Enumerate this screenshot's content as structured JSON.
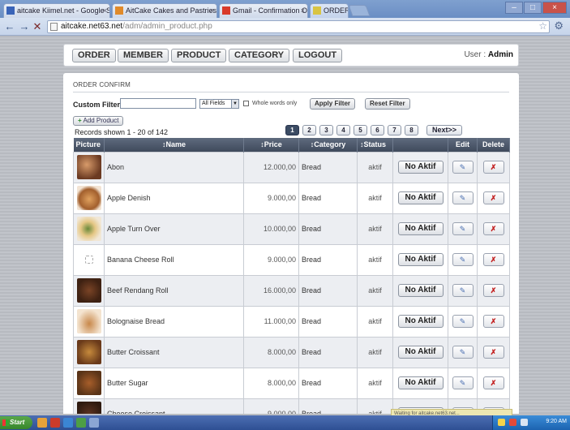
{
  "browser": {
    "tabs": [
      {
        "label": "aitcake Kiimel.net - Google S",
        "fav": "#3a64b8"
      },
      {
        "label": "AitCake Cakes and Pastries",
        "fav": "#e08a2a"
      },
      {
        "label": "Gmail - Confirmation Order",
        "fav": "#d93a2a"
      },
      {
        "label": "ORDER Order",
        "fav": "#d9c442"
      }
    ],
    "url_host": "aitcake.net63.net",
    "url_path": "/adm/admin_product.php",
    "close_glyph": "×",
    "window_buttons": [
      "–",
      "□",
      "×"
    ]
  },
  "nav": {
    "items": [
      "ORDER",
      "MEMBER",
      "PRODUCT",
      "CATEGORY",
      "LOGOUT"
    ],
    "user_label": "User :",
    "user_name": "Admin"
  },
  "content": {
    "section_title": "ORDER CONFIRM",
    "filter": {
      "label": "Custom Filter",
      "input_value": "",
      "field_select": "All Fields",
      "whole_words_label": "Whole words only",
      "apply_label": "Apply Filter",
      "reset_label": "Reset Filter"
    },
    "add_product": "Add Product",
    "records_text": "Records shown 1 - 20 of 142",
    "pagination": {
      "pages": [
        "1",
        "2",
        "3",
        "4",
        "5",
        "6",
        "7",
        "8"
      ],
      "active": "1",
      "next": "Next>>"
    },
    "columns": {
      "picture": "Picture",
      "name": "↕Name",
      "price": "↕Price",
      "category": "↕Category",
      "status": "↕Status",
      "edit": "Edit",
      "delete": "Delete"
    },
    "rows": [
      {
        "name": "Abon",
        "price": "12.000,00",
        "category": "Bread",
        "status": "aktif",
        "action": "No Aktif"
      },
      {
        "name": "Apple Denish",
        "price": "9.000,00",
        "category": "Bread",
        "status": "aktif",
        "action": "No Aktif"
      },
      {
        "name": "Apple Turn Over",
        "price": "10.000,00",
        "category": "Bread",
        "status": "aktif",
        "action": "No Aktif"
      },
      {
        "name": "Banana Cheese Roll",
        "price": "9.000,00",
        "category": "Bread",
        "status": "aktif",
        "action": "No Aktif"
      },
      {
        "name": "Beef Rendang Roll",
        "price": "16.000,00",
        "category": "Bread",
        "status": "aktif",
        "action": "No Aktif"
      },
      {
        "name": "Bolognaise Bread",
        "price": "11.000,00",
        "category": "Bread",
        "status": "aktif",
        "action": "No Aktif"
      },
      {
        "name": "Butter Croissant",
        "price": "8.000,00",
        "category": "Bread",
        "status": "aktif",
        "action": "No Aktif"
      },
      {
        "name": "Butter Sugar",
        "price": "8.000,00",
        "category": "Bread",
        "status": "aktif",
        "action": "No Aktif"
      },
      {
        "name": "Cheese Croissant",
        "price": "9.000,00",
        "category": "Bread",
        "status": "aktif",
        "action": "No Aktif"
      }
    ],
    "edit_glyph": "✎",
    "delete_glyph": "✗"
  },
  "status_bar": "Waiting for aitcake.net63.net...",
  "taskbar": {
    "start": "Start",
    "clock": "9:20 AM"
  },
  "colors": {
    "header_dark": "#3f4a5c",
    "delete_red": "#c32121",
    "page_bg": "#b7bac0"
  }
}
